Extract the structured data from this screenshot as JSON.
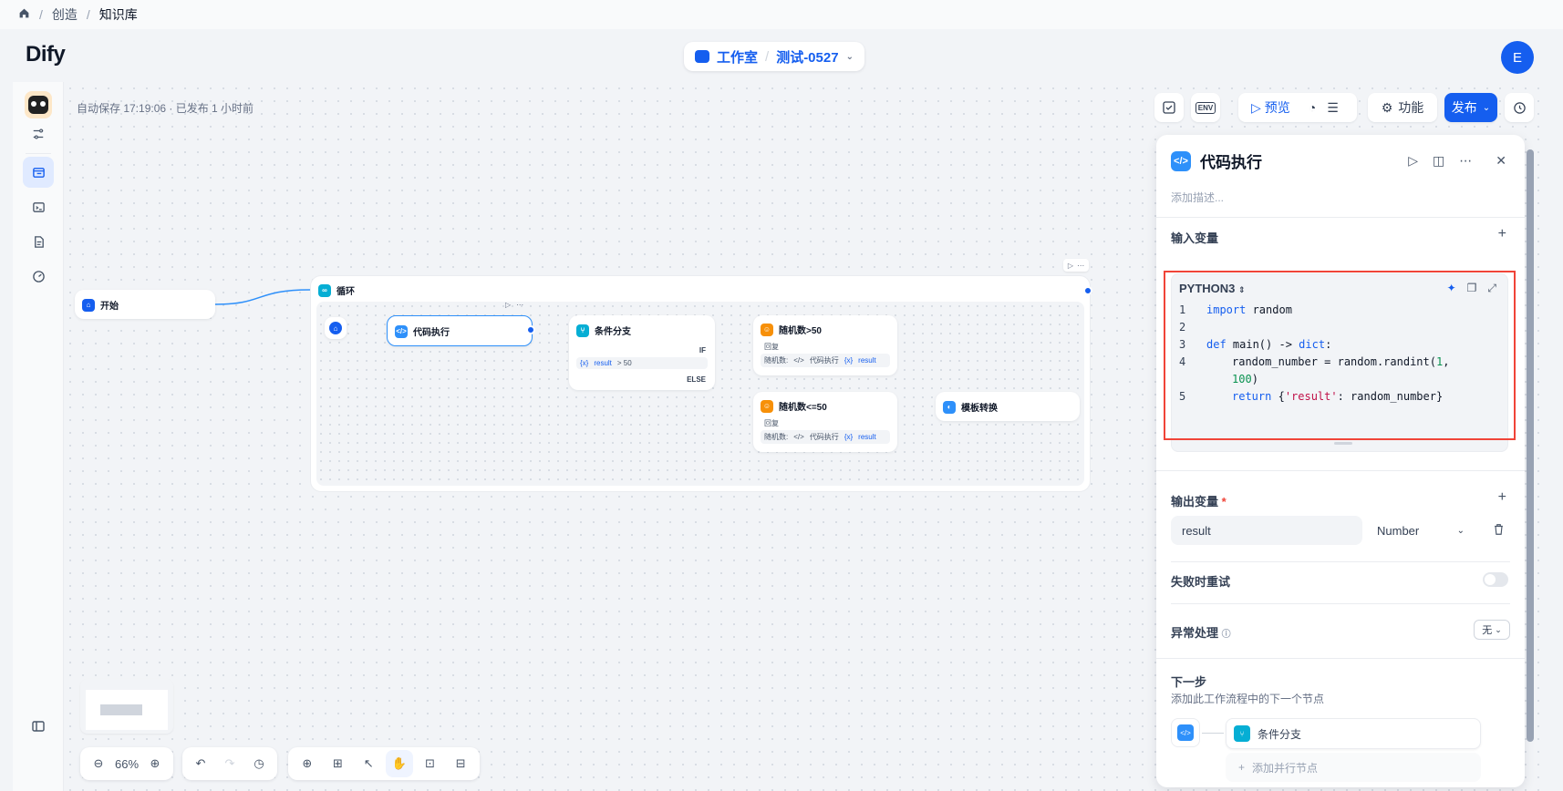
{
  "breadcrumb": {
    "items": [
      "创造",
      "知识库"
    ]
  },
  "header": {
    "logo": "Dify",
    "workspace_label": "工作室",
    "app_name": "测试-0527",
    "avatar_initial": "E"
  },
  "canvas": {
    "autosave_text": "自动保存 17:19:06 · 已发布 1 小时前"
  },
  "toolbar": {
    "env_label": "ENV",
    "preview_label": "预览",
    "features_label": "功能",
    "publish_label": "发布"
  },
  "nodes": {
    "start": {
      "title": "开始"
    },
    "loop": {
      "title": "循环"
    },
    "code": {
      "title": "代码执行"
    },
    "if_else": {
      "title": "条件分支",
      "if_label": "IF",
      "else_label": "ELSE",
      "condition_var": "result",
      "condition_op": "> 50"
    },
    "gt50": {
      "title": "随机数>50",
      "sub_title": "回复",
      "var_label": "随机数:",
      "var_source": "代码执行",
      "var_name": "result"
    },
    "le50": {
      "title": "随机数<=50",
      "sub_title": "回复",
      "var_label": "随机数:",
      "var_source": "代码执行",
      "var_name": "result"
    },
    "template": {
      "title": "模板转换"
    }
  },
  "panel": {
    "title": "代码执行",
    "description_placeholder": "添加描述...",
    "input_vars_label": "输入变量",
    "language": "PYTHON3",
    "code_lines": [
      {
        "n": "1",
        "text": "import random"
      },
      {
        "n": "2",
        "text": ""
      },
      {
        "n": "3",
        "text": "def main() -> dict:"
      },
      {
        "n": "4",
        "text": "random_number = random.randint(1, 100)"
      },
      {
        "n": "5",
        "text": "return {'result': random_number}"
      }
    ],
    "output_vars_label": "输出变量",
    "required_mark": "*",
    "output_var_name": "result",
    "output_var_type": "Number",
    "retry_label": "失败时重试",
    "error_label": "异常处理",
    "error_value": "无",
    "next_step_label": "下一步",
    "next_step_desc": "添加此工作流程中的下一个节点",
    "next_node_title": "条件分支",
    "add_parallel_label": "添加并行节点"
  },
  "zoom": {
    "level": "66%"
  }
}
